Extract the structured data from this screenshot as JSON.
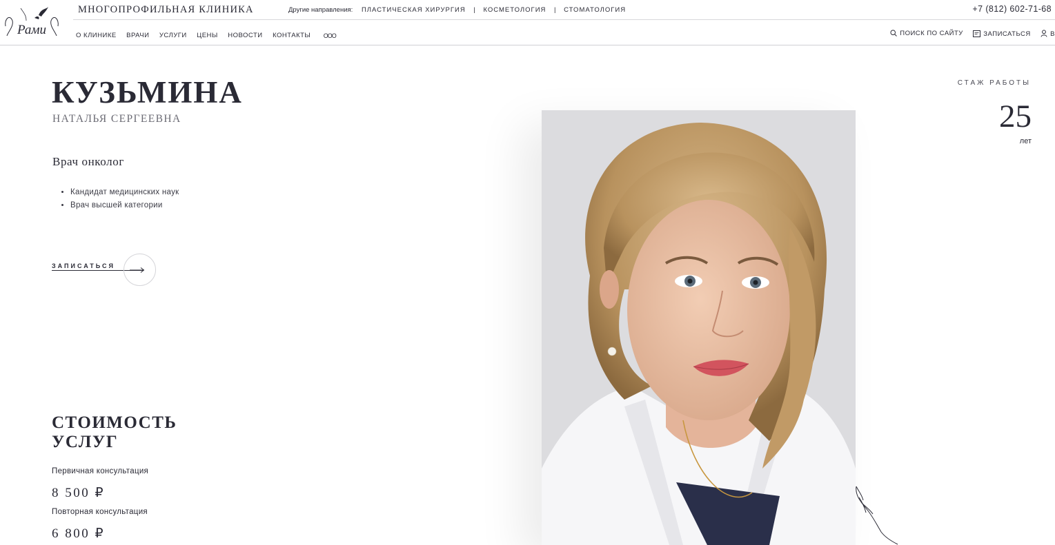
{
  "header": {
    "logo_text": "Рами",
    "clinic_name": "МНОГОПРОФИЛЬНАЯ КЛИНИКА",
    "other_label": "Другие направления:",
    "directions": [
      "ПЛАСТИЧЕСКАЯ ХИРУРГИЯ",
      "КОСМЕТОЛОГИЯ",
      "СТОМАТОЛОГИЯ"
    ],
    "separator": "|",
    "phone": "+7 (812) 602-71-68",
    "nav": [
      "О КЛИНИКЕ",
      "ВРАЧИ",
      "УСЛУГИ",
      "ЦЕНЫ",
      "НОВОСТИ",
      "КОНТАКТЫ"
    ],
    "more": "ооо",
    "search_label": "ПОИСК ПО САЙТУ",
    "book_label": "ЗАПИСАТЬСЯ",
    "account_label": "В"
  },
  "doctor": {
    "surname": "КУЗЬМИНА",
    "given_names": "НАТАЛЬЯ СЕРГЕЕВНА",
    "specialty": "Врач онколог",
    "qualifications": [
      "Кандидат медицинских наук",
      "Врач высшей категории"
    ],
    "cta_label": "ЗАПИСАТЬСЯ"
  },
  "experience": {
    "label": "СТАЖ РАБОТЫ",
    "value": "25",
    "unit": "лет"
  },
  "prices": {
    "title_line1": "СТОИМОСТЬ",
    "title_line2": "УСЛУГ",
    "items": [
      {
        "name": "Первичная консультация",
        "price": "8 500 ₽"
      },
      {
        "name": "Повторная консультация",
        "price": "6 800 ₽"
      }
    ]
  },
  "colors": {
    "text": "#2a2a35",
    "muted": "#6b6b74",
    "photo_bg": "#dcdcdf"
  }
}
